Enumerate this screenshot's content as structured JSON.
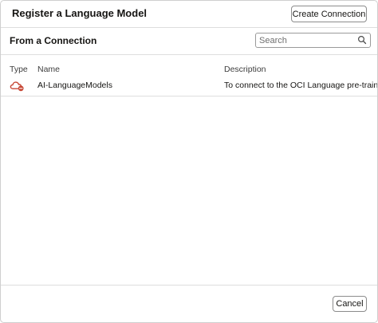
{
  "dialog": {
    "title": "Register a Language Model",
    "create_connection_label": "Create Connection",
    "cancel_label": "Cancel"
  },
  "section": {
    "title": "From a Connection"
  },
  "search": {
    "placeholder": "Search",
    "value": "",
    "icon": "search-icon"
  },
  "table": {
    "columns": [
      "Type",
      "Name",
      "Description"
    ],
    "rows": [
      {
        "type_icon": "cloud-icon",
        "name": "AI-LanguageModels",
        "description": "To connect to the OCI Language pre-trained"
      }
    ]
  },
  "colors": {
    "cloud_icon": "#c74634",
    "border": "#8c8c8c",
    "divider": "#dedede"
  }
}
